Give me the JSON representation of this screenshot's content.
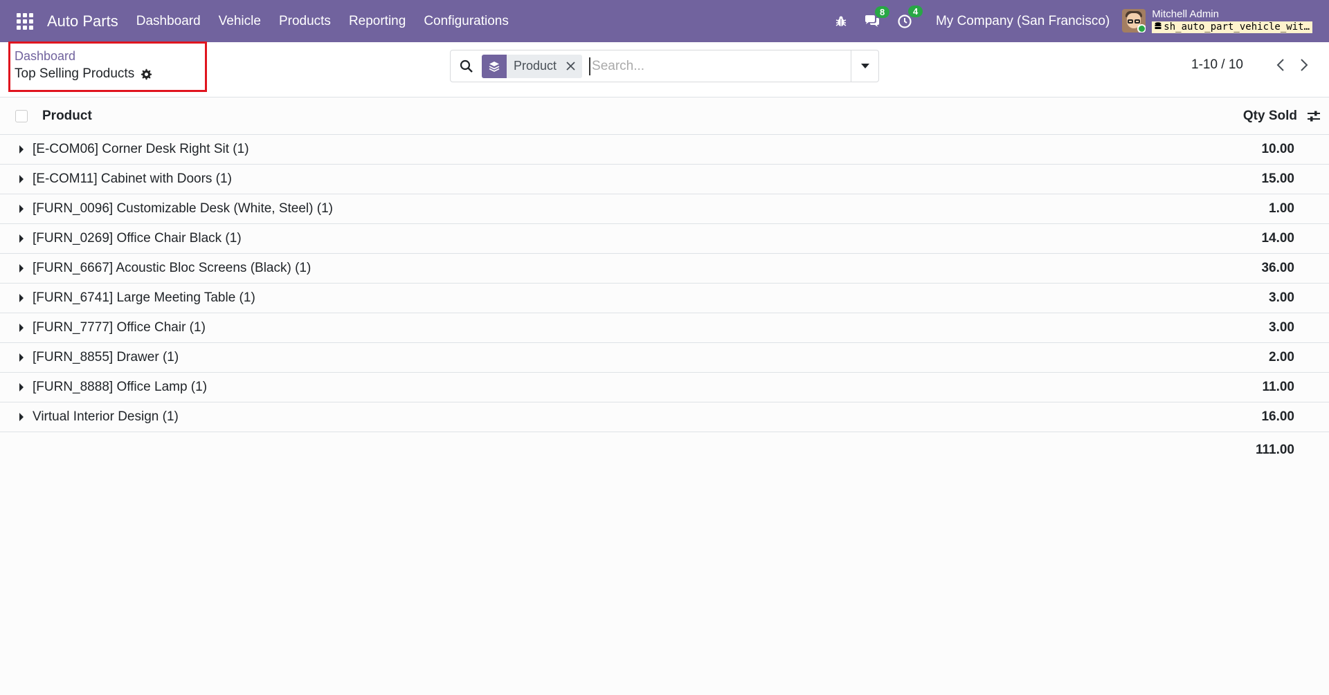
{
  "navbar": {
    "brand": "Auto Parts",
    "menu": [
      "Dashboard",
      "Vehicle",
      "Products",
      "Reporting",
      "Configurations"
    ],
    "messages_badge": "8",
    "activities_badge": "4",
    "company": "My Company (San Francisco)",
    "user_name": "Mitchell Admin",
    "db_name": "sh_auto_part_vehicle_wit…"
  },
  "control_panel": {
    "breadcrumb": "Dashboard",
    "title": "Top Selling Products",
    "facet_label": "Product",
    "search_placeholder": "Search...",
    "pager": "1-10 / 10"
  },
  "table": {
    "headers": {
      "product": "Product",
      "qty": "Qty Sold"
    },
    "rows": [
      {
        "name": "[E-COM06] Corner Desk Right Sit (1)",
        "qty": "10.00"
      },
      {
        "name": "[E-COM11] Cabinet with Doors (1)",
        "qty": "15.00"
      },
      {
        "name": "[FURN_0096] Customizable Desk (White, Steel) (1)",
        "qty": "1.00"
      },
      {
        "name": "[FURN_0269] Office Chair Black (1)",
        "qty": "14.00"
      },
      {
        "name": "[FURN_6667] Acoustic Bloc Screens (Black) (1)",
        "qty": "36.00"
      },
      {
        "name": "[FURN_6741] Large Meeting Table (1)",
        "qty": "3.00"
      },
      {
        "name": "[FURN_7777] Office Chair (1)",
        "qty": "3.00"
      },
      {
        "name": "[FURN_8855] Drawer (1)",
        "qty": "2.00"
      },
      {
        "name": "[FURN_8888] Office Lamp (1)",
        "qty": "11.00"
      },
      {
        "name": "Virtual Interior Design (1)",
        "qty": "16.00"
      }
    ],
    "total": "111.00"
  },
  "colors": {
    "navbar": "#71639e",
    "highlight": "#e0151f",
    "badge": "#28a745"
  }
}
